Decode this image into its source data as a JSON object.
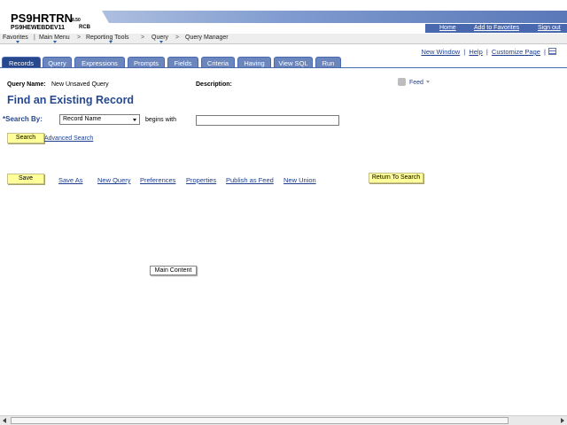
{
  "header": {
    "app_title": "PS9HRTRN",
    "version": "8.50",
    "database": "PS9HEWEBDEV11",
    "user": "RCB",
    "links": {
      "home": "Home",
      "worklist": "Add to Favorites",
      "signout": "Sign out"
    }
  },
  "nav": {
    "favorites": "Favorites",
    "main_menu": "Main Menu",
    "sep": ">",
    "reporting_tools": "Reporting Tools",
    "query": "Query",
    "query_manager": "Query Manager"
  },
  "toolbar": {
    "new_window": "New Window",
    "help": "Help",
    "customize": "Customize Page",
    "sep": "|"
  },
  "tabs": [
    {
      "label": "Records",
      "active": true
    },
    {
      "label": "Query"
    },
    {
      "label": "Expressions"
    },
    {
      "label": "Prompts"
    },
    {
      "label": "Fields"
    },
    {
      "label": "Criteria"
    },
    {
      "label": "Having"
    },
    {
      "label": "View SQL"
    },
    {
      "label": "Run"
    }
  ],
  "query_info": {
    "name_label": "Query Name:",
    "name_value": "New Unsaved Query",
    "description_label": "Description:",
    "feed_label": "Feed"
  },
  "page_title": "Find an Existing Record",
  "search": {
    "required_mark": "*",
    "label": "Search By:",
    "selected_option": "Record Name",
    "operator_text": "begins with",
    "input_value": "",
    "search_button": "Search",
    "advanced_link": "Advanced Search"
  },
  "actions": {
    "save": "Save",
    "save_as": "Save As",
    "new_query": "New Query",
    "preferences": "Preferences",
    "properties": "Properties",
    "publish_feed": "Publish as Feed",
    "new_union": "New Union",
    "return_to_search": "Return To Search"
  },
  "tooltip": "Main Content"
}
